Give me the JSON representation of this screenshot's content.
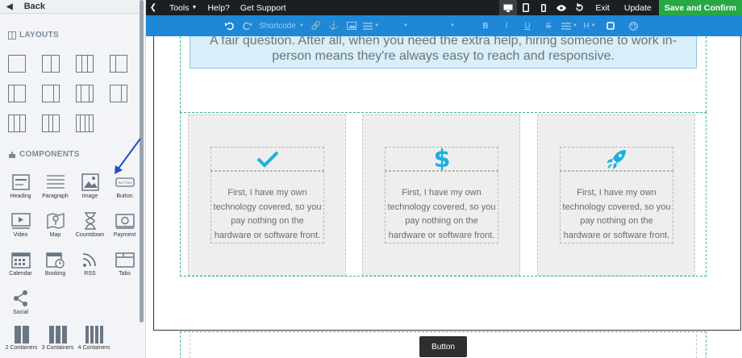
{
  "sidebar": {
    "back_label": "Back",
    "layouts_heading": "LAYOUTS",
    "components_heading": "COMPONENTS",
    "layouts": [
      1,
      2,
      3,
      4,
      2,
      3,
      4,
      3,
      3
    ],
    "components": [
      {
        "label": "Heading",
        "icon": "heading-icon"
      },
      {
        "label": "Paragraph",
        "icon": "paragraph-icon"
      },
      {
        "label": "Image",
        "icon": "image-icon"
      },
      {
        "label": "Button",
        "icon": "button-icon"
      },
      {
        "label": "Video",
        "icon": "video-icon"
      },
      {
        "label": "Map",
        "icon": "map-icon"
      },
      {
        "label": "Countdown",
        "icon": "hourglass-icon"
      },
      {
        "label": "Payment",
        "icon": "payment-icon"
      },
      {
        "label": "Calendar",
        "icon": "calendar-icon"
      },
      {
        "label": "Booking",
        "icon": "booking-icon"
      },
      {
        "label": "RSS",
        "icon": "rss-icon"
      },
      {
        "label": "Tabs",
        "icon": "tabs-icon"
      },
      {
        "label": "Social",
        "icon": "share-icon"
      }
    ],
    "containers": [
      {
        "label": "2 Containers",
        "bars": 2
      },
      {
        "label": "3 Containers",
        "bars": 3
      },
      {
        "label": "4 Containers",
        "bars": 4
      }
    ]
  },
  "topbar": {
    "tools_label": "Tools",
    "help_label": "Help?",
    "support_label": "Get Support",
    "exit_label": "Exit",
    "update_label": "Update",
    "save_label": "Save and Confirm"
  },
  "toolbar": {
    "shortcode_label": "Shortcode"
  },
  "canvas": {
    "quote_text": "A fair question. After all, when you need the extra help, hiring someone to work in-person means they're always easy to reach and responsive.",
    "columns": [
      {
        "icon": "checkmark-icon",
        "text": "First, I have my own technology covered, so you pay nothing on the hardware or software front."
      },
      {
        "icon": "dollar-icon",
        "text": "First, I have my own technology covered, so you pay nothing on the hardware or software front."
      },
      {
        "icon": "rocket-icon",
        "text": "First, I have my own technology covered, so you pay nothing on the hardware or software front."
      }
    ],
    "button_label": "Button"
  },
  "colors": {
    "accent": "#1ab0e0",
    "toolbar": "#1e88d7",
    "save": "#27a844",
    "guide": "#3eb489"
  }
}
